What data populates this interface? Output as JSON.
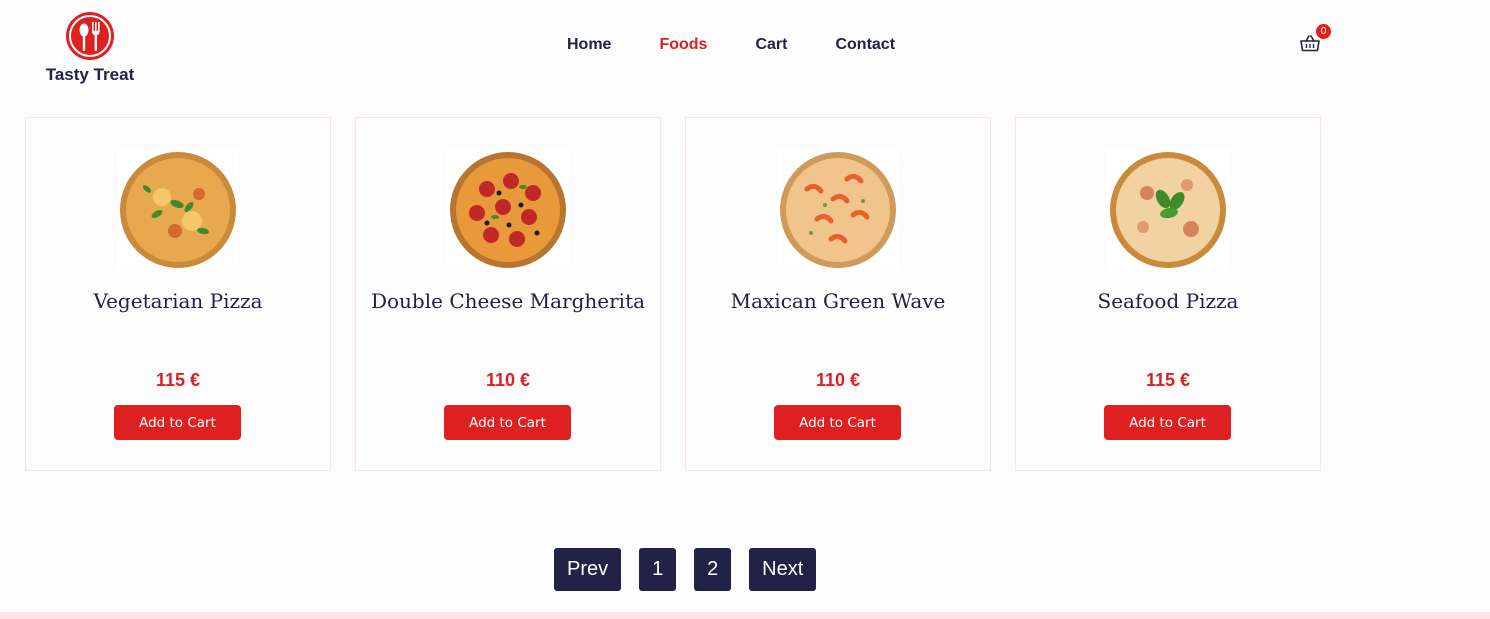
{
  "brand": {
    "name": "Tasty Treat",
    "logo_icon": "spoon-fork-icon",
    "accent_color": "#df2020",
    "dark_color": "#212245"
  },
  "nav": {
    "items": [
      {
        "label": "Home",
        "active": false
      },
      {
        "label": "Foods",
        "active": true
      },
      {
        "label": "Cart",
        "active": false
      },
      {
        "label": "Contact",
        "active": false
      }
    ]
  },
  "cart": {
    "icon": "shopping-basket-icon",
    "count": "0"
  },
  "products": [
    {
      "title": "Vegetarian Pizza",
      "price": "115 €",
      "button": "Add to Cart",
      "image": "vegetarian-pizza-image"
    },
    {
      "title": "Double Cheese Margherita",
      "price": "110 €",
      "button": "Add to Cart",
      "image": "pepperoni-pizza-image"
    },
    {
      "title": "Maxican Green Wave",
      "price": "110 €",
      "button": "Add to Cart",
      "image": "shrimp-pizza-image"
    },
    {
      "title": "Seafood Pizza",
      "price": "115 €",
      "button": "Add to Cart",
      "image": "basil-pizza-image"
    }
  ],
  "pagination": {
    "prev": "Prev",
    "pages": [
      "1",
      "2"
    ],
    "next": "Next"
  }
}
